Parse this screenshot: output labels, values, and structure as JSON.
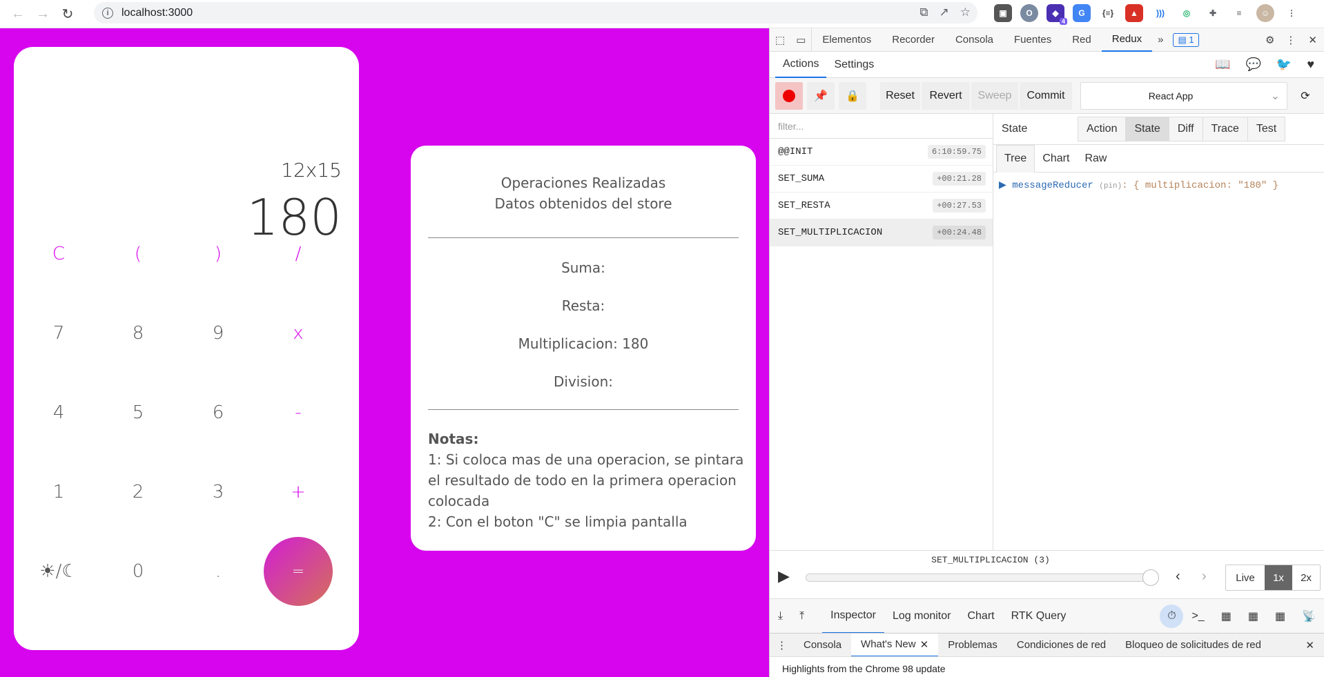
{
  "browser": {
    "url": "localhost:3000",
    "ext_badge": "4"
  },
  "calculator": {
    "expression": "12x15",
    "result": "180",
    "keys": [
      {
        "label": "C",
        "op": true
      },
      {
        "label": "(",
        "op": true
      },
      {
        "label": ")",
        "op": true
      },
      {
        "label": "/",
        "op": true
      },
      {
        "label": "7",
        "op": false
      },
      {
        "label": "8",
        "op": false
      },
      {
        "label": "9",
        "op": false
      },
      {
        "label": "x",
        "op": true
      },
      {
        "label": "4",
        "op": false
      },
      {
        "label": "5",
        "op": false
      },
      {
        "label": "6",
        "op": false
      },
      {
        "label": "-",
        "op": true
      },
      {
        "label": "1",
        "op": false
      },
      {
        "label": "2",
        "op": false
      },
      {
        "label": "3",
        "op": false
      },
      {
        "label": "+",
        "op": true
      },
      {
        "label": "☀/☾",
        "op": false
      },
      {
        "label": "0",
        "op": false
      },
      {
        "label": ".",
        "op": false
      },
      {
        "label": "=",
        "op": true
      }
    ]
  },
  "panel": {
    "title1": "Operaciones Realizadas",
    "title2": "Datos obtenidos del store",
    "suma": "Suma:",
    "resta": "Resta:",
    "multiplicacion": "Multiplicacion: 180",
    "division": "Division:",
    "notes_title": "Notas:",
    "note1": "1: Si coloca mas de una operacion, se pintara el resultado de todo en la primera operacion colocada",
    "note2": "2: Con el boton \"C\" se limpia pantalla"
  },
  "devtools": {
    "tabs": [
      "Elementos",
      "Recorder",
      "Consola",
      "Fuentes",
      "Red",
      "Redux"
    ],
    "issues_count": "1",
    "subtabs": [
      "Actions",
      "Settings"
    ],
    "toolbar": {
      "reset": "Reset",
      "revert": "Revert",
      "sweep": "Sweep",
      "commit": "Commit",
      "instance": "React App"
    },
    "filter_placeholder": "filter...",
    "actions": [
      {
        "name": "@@INIT",
        "time": "6:10:59.75"
      },
      {
        "name": "SET_SUMA",
        "time": "+00:21.28"
      },
      {
        "name": "SET_RESTA",
        "time": "+00:27.53"
      },
      {
        "name": "SET_MULTIPLICACION",
        "time": "+00:24.48"
      }
    ],
    "state_label": "State",
    "state_tabs": [
      "Action",
      "State",
      "Diff",
      "Trace",
      "Test"
    ],
    "tree_tabs": [
      "Tree",
      "Chart",
      "Raw"
    ],
    "tree_key": "messageReducer",
    "tree_pin": "(pin)",
    "tree_value": ": { multiplicacion: \"180\" }",
    "slider_label": "SET_MULTIPLICACION (3)",
    "slider_position": 1.0,
    "speed": [
      "Live",
      "1x",
      "2x"
    ],
    "bottom_tabs": [
      "Inspector",
      "Log monitor",
      "Chart",
      "RTK Query"
    ],
    "drawer_tabs": [
      "Consola",
      "What's New",
      "Problemas",
      "Condiciones de red",
      "Bloqueo de solicitudes de red"
    ],
    "drawer_text": "Highlights from the Chrome 98 update"
  }
}
